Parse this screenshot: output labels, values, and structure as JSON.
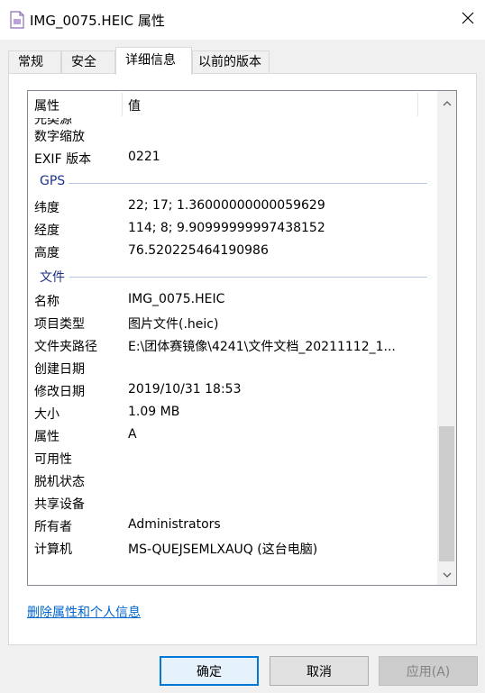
{
  "window": {
    "title": "IMG_0075.HEIC 属性"
  },
  "tabs": [
    {
      "label": "常规"
    },
    {
      "label": "安全"
    },
    {
      "label": "详细信息"
    },
    {
      "label": "以前的版本"
    }
  ],
  "table": {
    "col_property": "属性",
    "col_value": "值",
    "clipped_label": "光类源"
  },
  "rows_top": [
    {
      "key": "数字缩放",
      "value": ""
    },
    {
      "key": "EXIF 版本",
      "value": "0221"
    }
  ],
  "groups": {
    "gps": "GPS",
    "file": "文件"
  },
  "rows_gps": [
    {
      "key": "纬度",
      "value": "22; 17; 1.36000000000059629"
    },
    {
      "key": "经度",
      "value": "114; 8; 9.90999999997438152"
    },
    {
      "key": "高度",
      "value": "76.520225464190986"
    }
  ],
  "rows_file": [
    {
      "key": "名称",
      "value": "IMG_0075.HEIC"
    },
    {
      "key": "项目类型",
      "value": "图片文件(.heic)"
    },
    {
      "key": "文件夹路径",
      "value": "E:\\团体赛镜像\\4241\\文件文档_20211112_1..."
    },
    {
      "key": "创建日期",
      "value": ""
    },
    {
      "key": "修改日期",
      "value": "2019/10/31 18:53"
    },
    {
      "key": "大小",
      "value": "1.09 MB"
    },
    {
      "key": "属性",
      "value": "A"
    },
    {
      "key": "可用性",
      "value": ""
    },
    {
      "key": "脱机状态",
      "value": ""
    },
    {
      "key": "共享设备",
      "value": ""
    },
    {
      "key": "所有者",
      "value": "Administrators"
    },
    {
      "key": "计算机",
      "value": "MS-QUEJSEMLXAUQ (这台电脑)"
    }
  ],
  "link": {
    "label": "删除属性和个人信息"
  },
  "buttons": {
    "ok": "确定",
    "cancel": "取消",
    "apply": "应用(A)"
  },
  "colors": {
    "group_text": "#1e3287",
    "link": "#0066cc",
    "primary_border": "#0078d7"
  },
  "icons": [
    "file-icon",
    "close-icon",
    "scroll-up-icon",
    "scroll-down-icon"
  ]
}
